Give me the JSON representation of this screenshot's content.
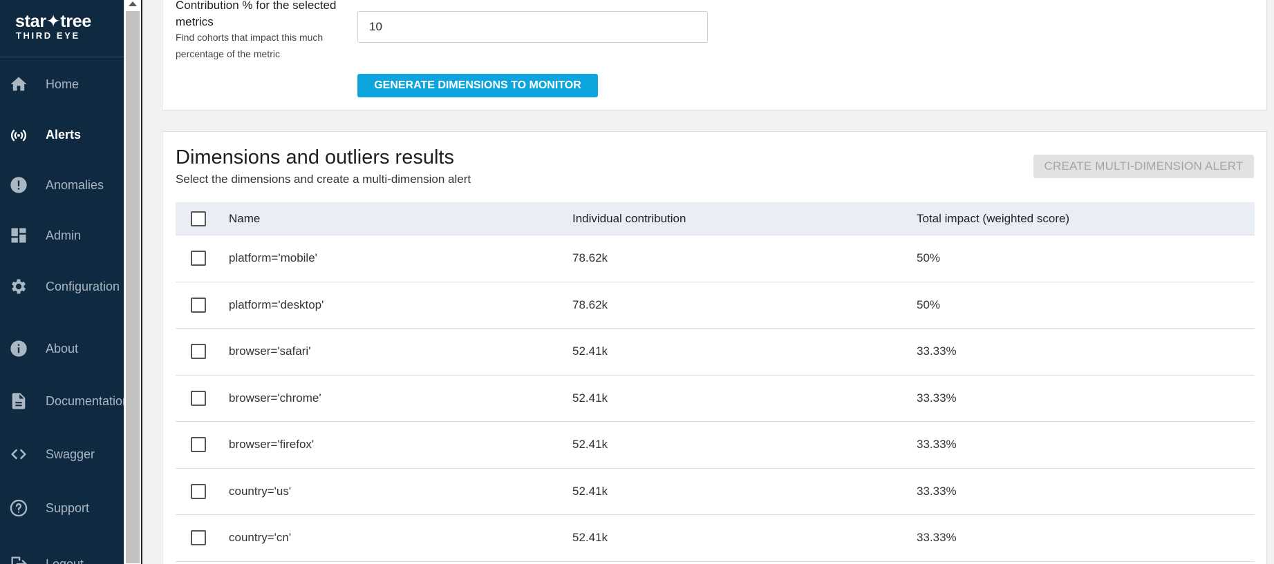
{
  "logo": {
    "line1": "star✦tree",
    "line2": "THIRD EYE"
  },
  "nav": {
    "items": [
      {
        "label": "Home",
        "icon": "home-icon",
        "active": false
      },
      {
        "label": "Alerts",
        "icon": "alerts-icon",
        "active": true
      },
      {
        "label": "Anomalies",
        "icon": "anomalies-icon",
        "active": false
      },
      {
        "label": "Admin",
        "icon": "admin-icon",
        "active": false
      },
      {
        "label": "Configuration",
        "icon": "gear-icon",
        "active": false
      },
      {
        "label": "About",
        "icon": "info-icon",
        "active": false
      },
      {
        "label": "Documentation",
        "icon": "document-icon",
        "active": false
      },
      {
        "label": "Swagger",
        "icon": "code-icon",
        "active": false
      },
      {
        "label": "Support",
        "icon": "help-icon",
        "active": false
      },
      {
        "label": "Logout",
        "icon": "logout-icon",
        "active": false
      }
    ]
  },
  "form": {
    "contribution_label": "Contribution % for the selected metrics",
    "contribution_helper": "Find cohorts that impact this much percentage of the metric",
    "contribution_value": "10",
    "generate_button": "GENERATE DIMENSIONS TO MONITOR"
  },
  "results": {
    "title": "Dimensions and outliers results",
    "subtitle": "Select the dimensions and create a multi-dimension alert",
    "create_button": "CREATE MULTI-DIMENSION ALERT",
    "columns": [
      "Name",
      "Individual contribution",
      "Total impact (weighted score)"
    ],
    "rows": [
      {
        "name": "platform='mobile'",
        "individual": "78.62k",
        "total": "50%"
      },
      {
        "name": "platform='desktop'",
        "individual": "78.62k",
        "total": "50%"
      },
      {
        "name": "browser='safari'",
        "individual": "52.41k",
        "total": "33.33%"
      },
      {
        "name": "browser='chrome'",
        "individual": "52.41k",
        "total": "33.33%"
      },
      {
        "name": "browser='firefox'",
        "individual": "52.41k",
        "total": "33.33%"
      },
      {
        "name": "country='us'",
        "individual": "52.41k",
        "total": "33.33%"
      },
      {
        "name": "country='cn'",
        "individual": "52.41k",
        "total": "33.33%"
      }
    ]
  },
  "colors": {
    "sidebar_bg": "#0f2a40",
    "primary_button": "#0ea5de",
    "table_header_bg": "#e9edf4"
  }
}
